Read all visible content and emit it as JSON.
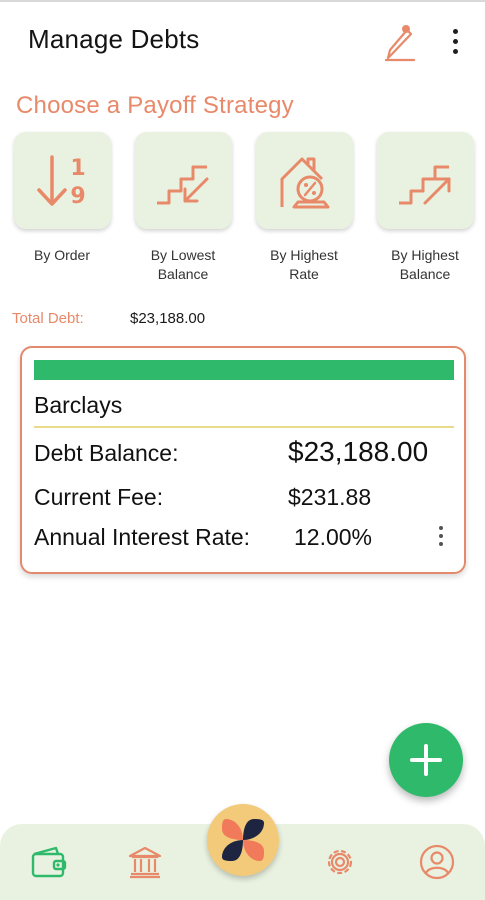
{
  "header": {
    "title": "Manage Debts",
    "edit_icon": "pencil-edit-icon",
    "menu_icon": "more-vertical-icon"
  },
  "strategy_section": {
    "title": "Choose a Payoff Strategy",
    "items": [
      {
        "label_line1": "By Order",
        "label_line2": "",
        "icon": "sort-order-icon"
      },
      {
        "label_line1": "By Lowest",
        "label_line2": "Balance",
        "icon": "stairs-down-icon"
      },
      {
        "label_line1": "By Highest",
        "label_line2": "Rate",
        "icon": "house-percent-icon"
      },
      {
        "label_line1": "By Highest",
        "label_line2": "Balance",
        "icon": "stairs-up-icon"
      }
    ]
  },
  "total": {
    "label": "Total Debt:",
    "value": "$23,188.00"
  },
  "debts": [
    {
      "name": "Barclays",
      "progress_percent": 100,
      "balance_label": "Debt Balance:",
      "balance_value": "$23,188.00",
      "fee_label": "Current Fee:",
      "fee_value": "$231.88",
      "rate_label": "Annual Interest Rate:",
      "rate_value": "12.00%"
    }
  ],
  "fab": {
    "icon": "plus-icon"
  },
  "bottom_nav": {
    "items": [
      {
        "name": "wallet",
        "icon": "wallet-icon",
        "active": true
      },
      {
        "name": "bank",
        "icon": "bank-icon",
        "active": false
      },
      {
        "name": "home",
        "icon": "app-logo-icon",
        "active": false
      },
      {
        "name": "settings",
        "icon": "gear-icon",
        "active": false
      },
      {
        "name": "profile",
        "icon": "user-icon",
        "active": false
      }
    ]
  },
  "colors": {
    "accent": "#e8896a",
    "green": "#2fba6b",
    "tile_bg": "#e9f2e1",
    "logo_bg": "#f3ca7a",
    "logo_dark": "#1d2541"
  }
}
